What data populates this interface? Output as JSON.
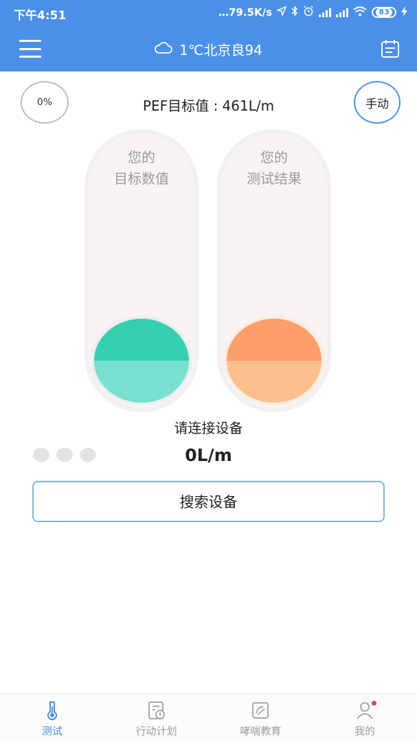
{
  "status_bar": {
    "time": "下午4:51",
    "network_speed": "…79.5K/s",
    "battery": "83",
    "icons": [
      "location-arrow-icon",
      "bluetooth-icon",
      "alarm-icon",
      "hd-signal-icon",
      "signal-icon",
      "wifi-icon",
      "battery-icon",
      "charging-icon"
    ]
  },
  "header": {
    "weather": "1℃北京良94",
    "weather_icon": "cloud-icon",
    "menu_icon": "menu-icon",
    "calendar_icon": "calendar-icon"
  },
  "top": {
    "progress": "0%",
    "pef_target": "PEF目标值 : 461L/m",
    "mode_button": "手动"
  },
  "tubes": {
    "target_label_line1": "您的",
    "target_label_line2": "目标数值",
    "result_label_line1": "您的",
    "result_label_line2": "测试结果"
  },
  "device": {
    "connect_prompt": "请连接设备",
    "reading": "0L/m",
    "search_button": "搜索设备"
  },
  "nav": {
    "items": [
      {
        "label": "测试",
        "icon": "thermometer-icon",
        "active": true
      },
      {
        "label": "行动计划",
        "icon": "clipboard-clock-icon",
        "active": false
      },
      {
        "label": "哮喘教育",
        "icon": "education-icon",
        "active": false
      },
      {
        "label": "我的",
        "icon": "user-icon",
        "active": false
      }
    ]
  },
  "colors": {
    "primary": "#4a90e8",
    "target_ball": "#33cfae",
    "result_ball": "#fe9e68",
    "notification_dot": "#e94040"
  }
}
